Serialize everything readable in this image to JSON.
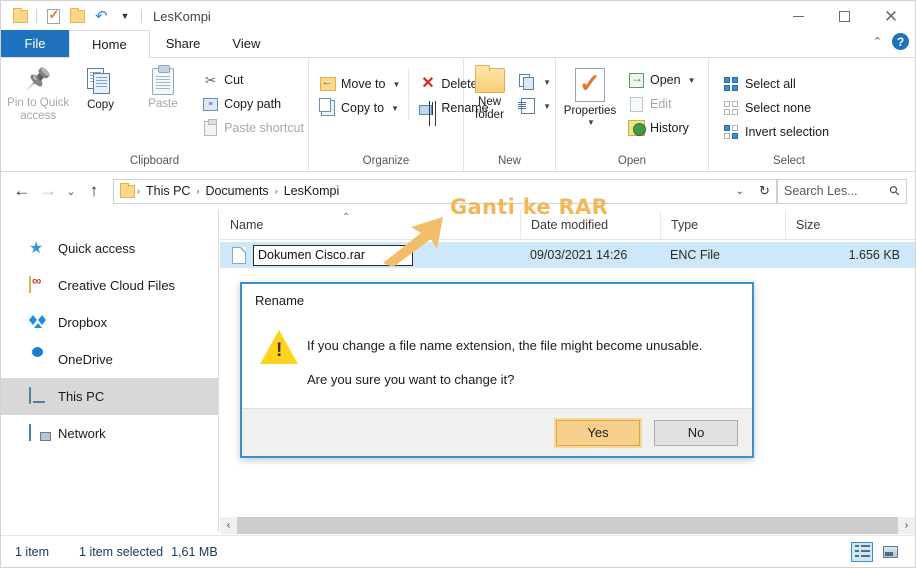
{
  "window": {
    "title": "LesKompi",
    "quick_access": [
      {
        "name": "folder-icon",
        "label": "Folder"
      },
      {
        "name": "properties-icon",
        "label": "Properties"
      },
      {
        "name": "new-folder-icon",
        "label": "New folder"
      },
      {
        "name": "undo-icon",
        "label": "Undo"
      },
      {
        "name": "customize-icon",
        "label": "Customize Quick Access Toolbar"
      }
    ],
    "controls": {
      "minimize": "Minimize",
      "maximize": "Maximize",
      "close": "Close"
    }
  },
  "tabs": [
    {
      "label": "File",
      "active": false,
      "kind": "file"
    },
    {
      "label": "Home",
      "active": true,
      "kind": "normal"
    },
    {
      "label": "Share",
      "active": false,
      "kind": "normal"
    },
    {
      "label": "View",
      "active": false,
      "kind": "normal"
    }
  ],
  "ribbon": {
    "collapse_label": "⌃",
    "help_label": "?",
    "groups": [
      {
        "label": "Clipboard",
        "big": [
          {
            "label_line1": "Pin to Quick",
            "label_line2": "access",
            "icon": "pin-icon",
            "disabled": true
          },
          {
            "label_line1": "Copy",
            "label_line2": "",
            "icon": "copy-icon",
            "disabled": false
          },
          {
            "label_line1": "Paste",
            "label_line2": "",
            "icon": "paste-icon",
            "disabled": true
          }
        ],
        "small": [
          {
            "label": "Cut",
            "icon": "scissors-icon",
            "disabled": false
          },
          {
            "label": "Copy path",
            "icon": "copy-path-icon",
            "disabled": false
          },
          {
            "label": "Paste shortcut",
            "icon": "paste-shortcut-icon",
            "disabled": true
          }
        ]
      },
      {
        "label": "Organize",
        "small_left": [
          {
            "label": "Move to",
            "icon": "move-to-icon",
            "caret": true
          },
          {
            "label": "Copy to",
            "icon": "copy-to-icon",
            "caret": true
          }
        ],
        "small_right": [
          {
            "label": "Delete",
            "icon": "delete-icon",
            "caret": true
          },
          {
            "label": "Rename",
            "icon": "rename-icon",
            "caret": false
          }
        ]
      },
      {
        "label": "New",
        "big": [
          {
            "label_line1": "New",
            "label_line2": "folder",
            "icon": "new-folder-icon"
          }
        ],
        "small": [
          {
            "label": "",
            "icon": "new-item-icon",
            "caret": true
          },
          {
            "label": "",
            "icon": "easy-access-icon",
            "caret": true
          }
        ]
      },
      {
        "label": "Open",
        "big": [
          {
            "label_line1": "Properties",
            "label_line2": "",
            "icon": "properties-icon",
            "caret": true
          }
        ],
        "small": [
          {
            "label": "Open",
            "icon": "open-icon",
            "caret": true,
            "disabled": false
          },
          {
            "label": "Edit",
            "icon": "edit-icon",
            "caret": false,
            "disabled": true
          },
          {
            "label": "History",
            "icon": "history-icon",
            "caret": false,
            "disabled": false
          }
        ]
      },
      {
        "label": "Select",
        "small": [
          {
            "label": "Select all",
            "icon": "select-all-icon"
          },
          {
            "label": "Select none",
            "icon": "select-none-icon"
          },
          {
            "label": "Invert selection",
            "icon": "invert-selection-icon"
          }
        ]
      }
    ]
  },
  "address": {
    "back": "←",
    "forward": "→",
    "recent": "⌄",
    "up": "↑",
    "breadcrumbs": [
      "This PC",
      "Documents",
      "LesKompi"
    ],
    "separator": "›",
    "dropdown": "⌄",
    "refresh": "↻",
    "search_value": "Search Les...",
    "search_placeholder": "Search LesKompi"
  },
  "sidebar": {
    "items": [
      {
        "label": "Quick access",
        "icon": "star-icon",
        "selected": false
      },
      {
        "label": "Creative Cloud Files",
        "icon": "creative-cloud-icon",
        "selected": false
      },
      {
        "label": "Dropbox",
        "icon": "dropbox-icon",
        "selected": false
      },
      {
        "label": "OneDrive",
        "icon": "onedrive-icon",
        "selected": false
      },
      {
        "label": "This PC",
        "icon": "this-pc-icon",
        "selected": true
      },
      {
        "label": "Network",
        "icon": "network-icon",
        "selected": false
      }
    ]
  },
  "filelist": {
    "columns": [
      {
        "label": "Name",
        "sorted": true,
        "sort_glyph": "⌃"
      },
      {
        "label": "Date modified",
        "sorted": false
      },
      {
        "label": "Type",
        "sorted": false
      },
      {
        "label": "Size",
        "sorted": false
      }
    ],
    "rows": [
      {
        "name_value": "Dokumen Cisco.rar",
        "editing": true,
        "date_modified": "09/03/2021 14:26",
        "type": "ENC File",
        "size": "1.656 KB",
        "selected": true
      }
    ]
  },
  "annotation": {
    "text": "Ganti ke RAR",
    "color": "#f2b75b",
    "arrow": "arrow-pointing-to-filename"
  },
  "dialog": {
    "title": "Rename",
    "icon": "warning-icon",
    "message_line1": "If you change a file name extension, the file might become unusable.",
    "message_line2": "Are you sure you want to change it?",
    "buttons": [
      {
        "label": "Yes",
        "primary": true
      },
      {
        "label": "No",
        "primary": false
      }
    ],
    "border_color": "#3a8fd0"
  },
  "scrollbar": {
    "left_arrow": "‹",
    "right_arrow": "›"
  },
  "status": {
    "item_count": "1 item",
    "selected_text": "1 item selected",
    "selected_size": "1,61 MB",
    "view_modes": [
      {
        "name": "details-view",
        "active": true
      },
      {
        "name": "large-icons-view",
        "active": false
      }
    ]
  }
}
